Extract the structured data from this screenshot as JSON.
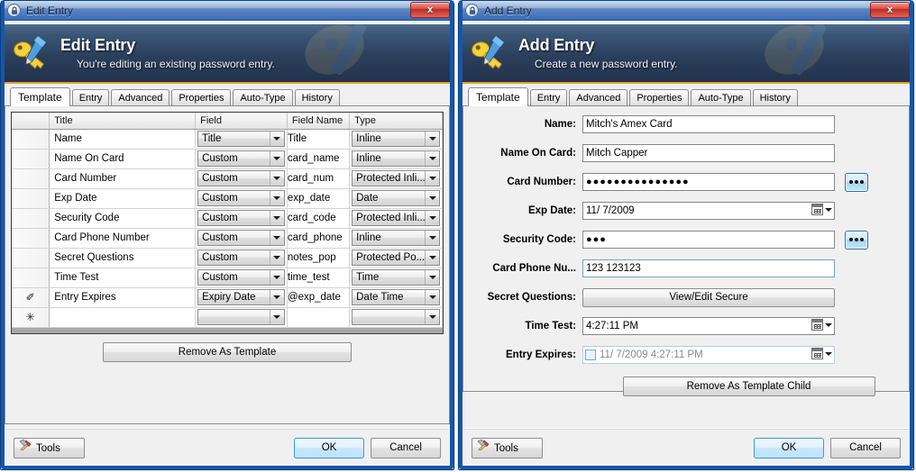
{
  "left_window": {
    "titlebar": {
      "title": "Edit Entry",
      "icon": "lock-icon",
      "close_label": "x"
    },
    "banner": {
      "heading": "Edit Entry",
      "subtitle": "You're editing an existing password entry.",
      "icon": "key-pencil-icon"
    },
    "tabs": [
      {
        "label": "Template",
        "active": true
      },
      {
        "label": "Entry",
        "active": false
      },
      {
        "label": "Advanced",
        "active": false
      },
      {
        "label": "Properties",
        "active": false
      },
      {
        "label": "Auto-Type",
        "active": false
      },
      {
        "label": "History",
        "active": false
      }
    ],
    "grid": {
      "headers": [
        "",
        "Title",
        "Field",
        "Field Name",
        "Type"
      ],
      "rows": [
        {
          "marker": "",
          "title": "Name",
          "field": "Title",
          "field_name": "Title",
          "type": "Inline"
        },
        {
          "marker": "",
          "title": "Name On Card",
          "field": "Custom",
          "field_name": "card_name",
          "type": "Inline"
        },
        {
          "marker": "",
          "title": "Card Number",
          "field": "Custom",
          "field_name": "card_num",
          "type": "Protected Inli..."
        },
        {
          "marker": "",
          "title": "Exp Date",
          "field": "Custom",
          "field_name": "exp_date",
          "type": "Date"
        },
        {
          "marker": "",
          "title": "Security Code",
          "field": "Custom",
          "field_name": "card_code",
          "type": "Protected Inli..."
        },
        {
          "marker": "",
          "title": "Card Phone Number",
          "field": "Custom",
          "field_name": "card_phone",
          "type": "Inline"
        },
        {
          "marker": "",
          "title": "Secret Questions",
          "field": "Custom",
          "field_name": "notes_pop",
          "type": "Protected Po..."
        },
        {
          "marker": "",
          "title": "Time Test",
          "field": "Custom",
          "field_name": "time_test",
          "type": "Time"
        },
        {
          "marker": "✐",
          "title": "Entry Expires",
          "field": "Expiry Date",
          "field_name": "@exp_date",
          "type": "Date Time"
        },
        {
          "marker": "✳",
          "title": "",
          "field": "",
          "field_name": "",
          "type": ""
        }
      ]
    },
    "remove_template_label": "Remove As Template",
    "footer": {
      "tools_label": "Tools",
      "ok_label": "OK",
      "cancel_label": "Cancel",
      "tools_icon": "tools-hammer-icon"
    }
  },
  "right_window": {
    "titlebar": {
      "title": "Add Entry",
      "icon": "lock-icon",
      "close_label": "x"
    },
    "banner": {
      "heading": "Add Entry",
      "subtitle": "Create a new password entry.",
      "icon": "key-pencil-icon"
    },
    "tabs": [
      {
        "label": "Template",
        "active": true
      },
      {
        "label": "Entry",
        "active": false
      },
      {
        "label": "Advanced",
        "active": false
      },
      {
        "label": "Properties",
        "active": false
      },
      {
        "label": "Auto-Type",
        "active": false
      },
      {
        "label": "History",
        "active": false
      }
    ],
    "fields": {
      "name": {
        "label": "Name:",
        "value": "Mitch's Amex Card"
      },
      "name_on_card": {
        "label": "Name On Card:",
        "value": "Mitch Capper"
      },
      "card_number": {
        "label": "Card Number:",
        "value": "●●●●●●●●●●●●●●●",
        "generator_label": "•••"
      },
      "exp_date": {
        "label": "Exp Date:",
        "value": "11/  7/2009"
      },
      "security_code": {
        "label": "Security Code:",
        "value": "●●●",
        "generator_label": "•••"
      },
      "card_phone": {
        "label": "Card Phone Nu...",
        "value": "123 123123"
      },
      "secret_questions": {
        "label": "Secret Questions:",
        "button_label": "View/Edit Secure"
      },
      "time_test": {
        "label": "Time Test:",
        "value": "4:27:11 PM"
      },
      "entry_expires": {
        "label": "Entry Expires:",
        "value": "11/  7/2009  4:27:11 PM",
        "checked": false
      }
    },
    "remove_template_child_label": "Remove As Template Child",
    "footer": {
      "tools_label": "Tools",
      "ok_label": "OK",
      "cancel_label": "Cancel",
      "tools_icon": "tools-hammer-icon"
    }
  },
  "colors": {
    "title_gradient_top": "#a6bede",
    "title_gradient_bottom": "#3d6cb4",
    "window_border": "#1757a8",
    "banner_dark": "#22334b",
    "banner_accent": "#e89b2c",
    "close_red": "#bd2a22",
    "grid_empty_gray": "#a8a8a8",
    "ok_button_blue": "#3c9ad4"
  }
}
